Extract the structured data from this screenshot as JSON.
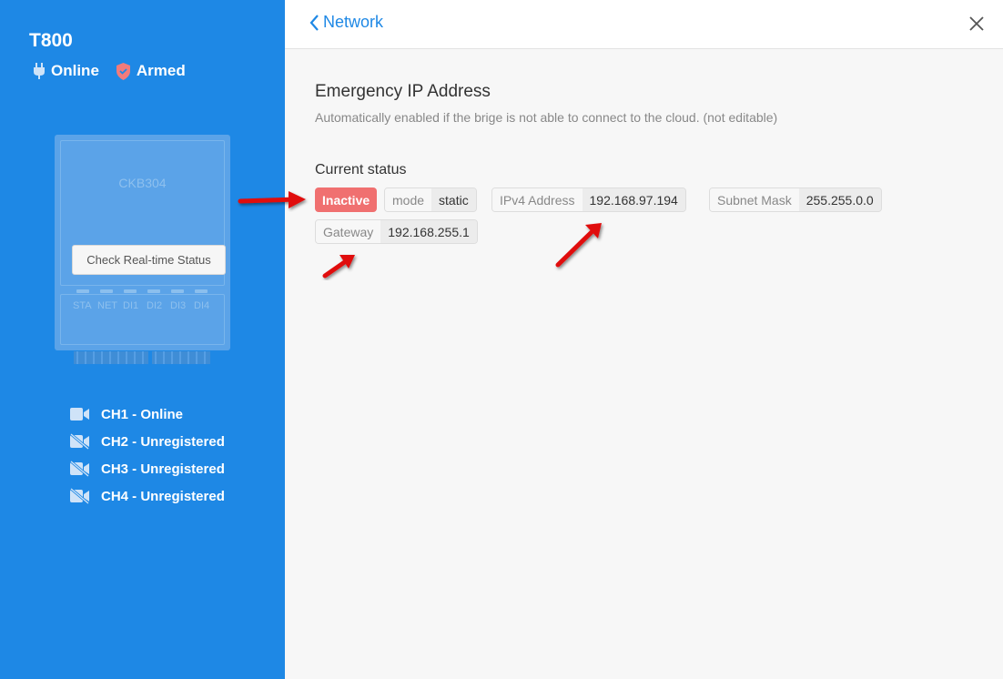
{
  "device": {
    "name": "T800",
    "connection": "Online",
    "arm_state": "Armed",
    "model": "CKB304",
    "check_button": "Check Real-time Status",
    "leds": [
      "STA",
      "NET",
      "DI1",
      "DI2",
      "DI3",
      "DI4"
    ]
  },
  "channels": [
    {
      "label": "CH1 - Online",
      "icon": "camera-icon"
    },
    {
      "label": "CH2 - Unregistered",
      "icon": "camera-off-icon"
    },
    {
      "label": "CH3 - Unregistered",
      "icon": "camera-off-icon"
    },
    {
      "label": "CH4 - Unregistered",
      "icon": "camera-off-icon"
    }
  ],
  "header": {
    "back_label": "Network"
  },
  "section": {
    "title": "Emergency IP Address",
    "description": "Automatically enabled if the brige is not able to connect to the cloud. (not editable)",
    "current_status_label": "Current status"
  },
  "status": {
    "state": "Inactive",
    "mode_key": "mode",
    "mode_value": "static",
    "ipv4_key": "IPv4 Address",
    "ipv4_value": "192.168.97.194",
    "subnet_key": "Subnet Mask",
    "subnet_value": "255.255.0.0",
    "gateway_key": "Gateway",
    "gateway_value": "192.168.255.1"
  },
  "colors": {
    "sidebar": "#1e88e5",
    "accent": "#1e88e5",
    "inactive_badge": "#f07070",
    "armed_shield": "#f27b7b",
    "annotation_arrow": "#e01010"
  }
}
